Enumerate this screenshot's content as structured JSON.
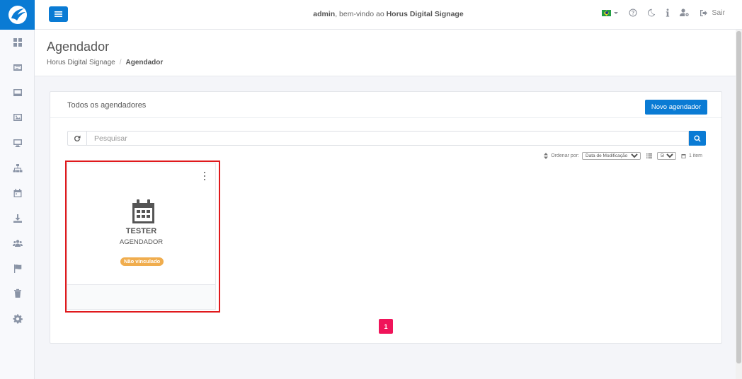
{
  "topbar": {
    "welcome_user": "admin",
    "welcome_text": ", bem-vindo ao ",
    "welcome_app": "Horus Digital Signage",
    "logout_label": "Sair"
  },
  "header": {
    "title": "Agendador",
    "breadcrumb": [
      "Horus Digital Signage",
      "Agendador"
    ]
  },
  "card": {
    "title": "Todos os agendadores",
    "new_button": "Novo agendador"
  },
  "search": {
    "placeholder": "Pesquisar"
  },
  "sort": {
    "label": "Ordenar por:",
    "selected": "Data de Modificação (",
    "page_size": "50",
    "item_count": "1 item"
  },
  "items": [
    {
      "name": "TESTER",
      "type": "AGENDADOR",
      "status": "Não vinculado"
    }
  ],
  "pagination": {
    "current": "1"
  },
  "colors": {
    "primary": "#0a7bd4",
    "badge": "#f0ad4e",
    "page_active": "#f0145a",
    "highlight": "#e0191c"
  },
  "sidebar_icons": [
    "dashboard-icon",
    "media-icon",
    "layout-icon",
    "gallery-icon",
    "display-icon",
    "hierarchy-icon",
    "calendar-icon",
    "download-icon",
    "users-icon",
    "flag-icon",
    "trash-icon",
    "settings-icon"
  ]
}
